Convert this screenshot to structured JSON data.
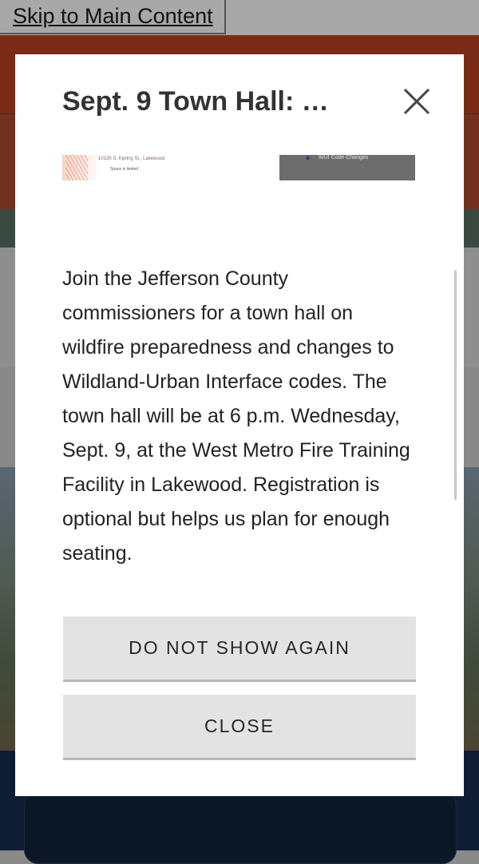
{
  "skip_link": {
    "label": "Skip to Main Content"
  },
  "modal": {
    "title": "Sept. 9 Town Hall: …",
    "thumbnail_left": {
      "line1": "10135 S. Kipling St., Lakewood",
      "line2": "Space is limited"
    },
    "thumbnail_right": {
      "caption": "WUI Code Changes"
    },
    "body": "Join the Jefferson County commissioners for a town hall on wildfire preparedness and changes to Wildland-Urban Interface codes. The town hall will be at 6 p.m. Wednesday, Sept. 9, at the West Metro Fire Training Facility in Lakewood. Registration is optional but helps us plan for enough seating.",
    "buttons": {
      "dont_show": "DO NOT SHOW AGAIN",
      "close": "CLOSE"
    }
  },
  "icons": {
    "close": "close-icon",
    "play": "play-icon"
  },
  "colors": {
    "overlay": "#8a8a8a",
    "title_text": "#333333",
    "button_bg": "#e3e3e3",
    "footer_navy": "#0f1d33"
  }
}
